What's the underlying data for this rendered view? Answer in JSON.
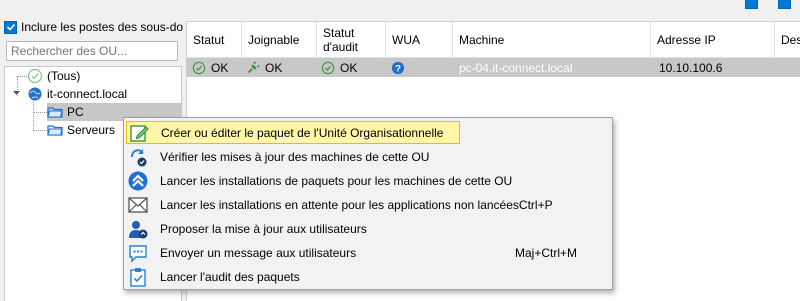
{
  "left_panel": {
    "include_label": "Inclure les postes des sous-do",
    "include_checked": true,
    "search_placeholder": "Rechercher des OU...",
    "tree": {
      "all": "(Tous)",
      "domain": "it-connect.local",
      "children": [
        {
          "label": "PC",
          "selected": true
        },
        {
          "label": "Serveurs",
          "selected": false
        }
      ]
    }
  },
  "grid": {
    "columns": [
      "Statut",
      "Joignable",
      "Statut\nd'audit",
      "WUA",
      "Machine",
      "Adresse IP",
      "Des"
    ],
    "rows": [
      {
        "statut": "OK",
        "joignable": "OK",
        "audit": "OK",
        "wua": "?",
        "machine": "pc-04.it-connect.local",
        "ip": "10.10.100.6"
      }
    ]
  },
  "context_menu": {
    "items": [
      {
        "label": "Créer ou éditer le paquet de l'Unité Organisationnelle",
        "shortcut": "",
        "icon": "pencil-edit-icon",
        "highlighted": true
      },
      {
        "label": "Vérifier les mises à jour des machines de cette OU",
        "shortcut": "",
        "icon": "refresh-check-icon",
        "highlighted": false
      },
      {
        "label": "Lancer les installations de paquets pour les machines de cette OU",
        "shortcut": "",
        "icon": "double-chevron-up-icon",
        "highlighted": false
      },
      {
        "label": "Lancer les installations en attente pour les applications non lancées",
        "shortcut": "Ctrl+P",
        "icon": "envelope-icon",
        "highlighted": false
      },
      {
        "label": "Proposer la mise à jour aux utilisateurs",
        "shortcut": "",
        "icon": "user-upgrade-icon",
        "highlighted": false
      },
      {
        "label": "Envoyer un message aux utilisateurs",
        "shortcut": "Maj+Ctrl+M",
        "icon": "chat-bubble-icon",
        "highlighted": false
      },
      {
        "label": "Lancer l'audit des paquets",
        "shortcut": "",
        "icon": "clipboard-check-icon",
        "highlighted": false
      }
    ]
  },
  "colors": {
    "accent": "#0078d4",
    "ok_green": "#3a9a3a",
    "highlight": "#fff6a8",
    "highlight_border": "#e3c200",
    "row_selected": "#c8c8c8"
  }
}
